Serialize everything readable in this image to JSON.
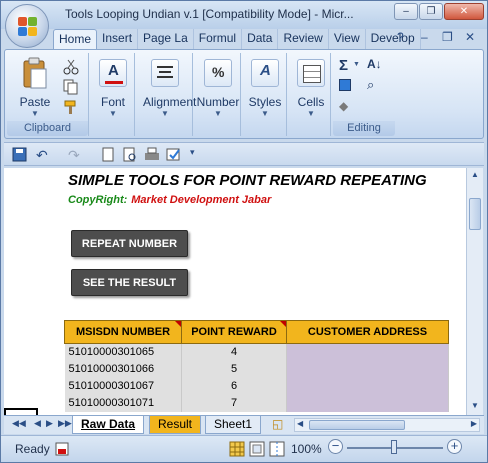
{
  "window": {
    "title": "Tools Looping Undian v.1  [Compatibility Mode] - Micr...",
    "minimize": "–",
    "restore": "❐",
    "close": "✕"
  },
  "ribbon_tabs": [
    {
      "label": "Home",
      "active": true
    },
    {
      "label": "Insert"
    },
    {
      "label": "Page La"
    },
    {
      "label": "Formul"
    },
    {
      "label": "Data"
    },
    {
      "label": "Review"
    },
    {
      "label": "View"
    },
    {
      "label": "Develop"
    }
  ],
  "ribbon": {
    "help": "?",
    "clipboard": {
      "paste": "Paste",
      "label": "Clipboard"
    },
    "font": {
      "label": "Font"
    },
    "alignment": {
      "label": "Alignment"
    },
    "number": {
      "label": "Number"
    },
    "styles": {
      "label": "Styles"
    },
    "cells": {
      "label": "Cells"
    },
    "editing": {
      "label": "Editing"
    }
  },
  "sheet": {
    "title": "SIMPLE TOOLS FOR POINT REWARD REPEATING",
    "copyright_label": "CopyRight:",
    "copyright_owner": "Market Development Jabar",
    "buttons": {
      "repeat": "REPEAT NUMBER",
      "result": "SEE THE RESULT"
    },
    "table": {
      "headers": [
        "MSISDN NUMBER",
        "POINT REWARD",
        "CUSTOMER ADDRESS"
      ],
      "rows": [
        [
          "51010000301065",
          "4",
          ""
        ],
        [
          "51010000301066",
          "5",
          ""
        ],
        [
          "51010000301067",
          "6",
          ""
        ],
        [
          "51010000301071",
          "7",
          ""
        ]
      ]
    }
  },
  "sheet_tabs": {
    "tabs": [
      "Raw Data",
      "Result",
      "Sheet1"
    ],
    "active": "Raw Data"
  },
  "status": {
    "ready": "Ready",
    "zoom": "100%"
  }
}
